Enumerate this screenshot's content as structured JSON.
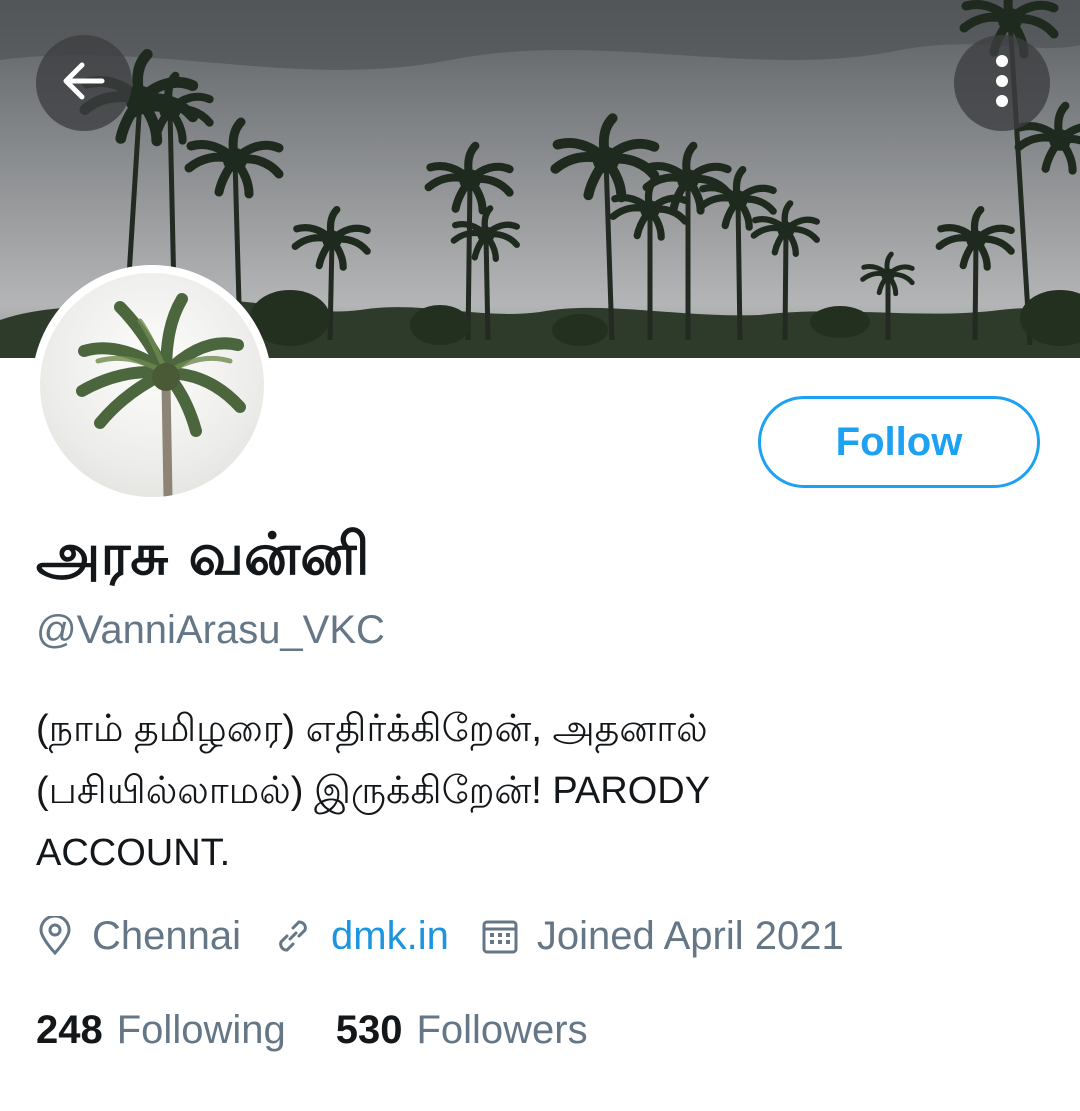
{
  "header": {
    "back_icon": "arrow-left-icon",
    "more_icon": "more-vertical-icon"
  },
  "profile": {
    "display_name": "அரசு வன்னி",
    "handle": "@VanniArasu_VKC",
    "follow_label": "Follow",
    "bio_lines": [
      "(நாம் தமிழரை) எதிர்க்கிறேன், அதனால்",
      "(பசியில்லாமல்)  இருக்கிறேன்! PARODY",
      "ACCOUNT."
    ],
    "location": "Chennai",
    "website": "dmk.in",
    "joined": "Joined April 2021",
    "following_count": "248",
    "following_label": "Following",
    "followers_count": "530",
    "followers_label": "Followers"
  },
  "colors": {
    "accent": "#1da1f2",
    "link": "#1b95e0",
    "text_primary": "#14171a",
    "text_secondary": "#657786"
  }
}
